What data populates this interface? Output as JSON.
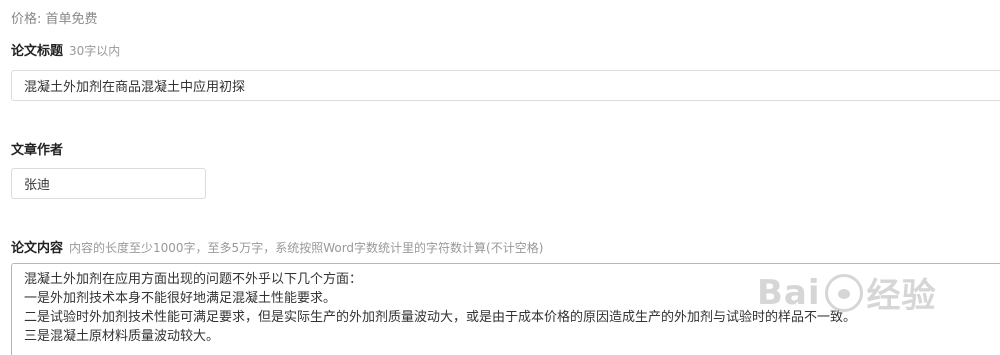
{
  "price": {
    "text": "价格: 首单免费"
  },
  "title_section": {
    "label": "论文标题",
    "hint": "30字以内",
    "value": "混凝土外加剂在商品混凝土中应用初探"
  },
  "author_section": {
    "label": "文章作者",
    "value": "张迪"
  },
  "content_section": {
    "label": "论文内容",
    "hint": "内容的长度至少1000字，至多5万字，系统按照Word字数统计里的字符数计算(不计空格)",
    "lines": [
      "混凝土外加剂在应用方面出现的问题不外乎以下几个方面：",
      "一是外加剂技术本身不能很好地满足混凝土性能要求。",
      "二是试验时外加剂技术性能可满足要求，但是实际生产的外加剂质量波动大，或是由于成本价格的原因造成生产的外加剂与试验时的样品不一致。",
      "三是混凝土原材料质量波动较大。"
    ]
  },
  "watermark": {
    "text_left": "Bai",
    "text_right": "经验",
    "icon": "baidu-paw-icon"
  }
}
